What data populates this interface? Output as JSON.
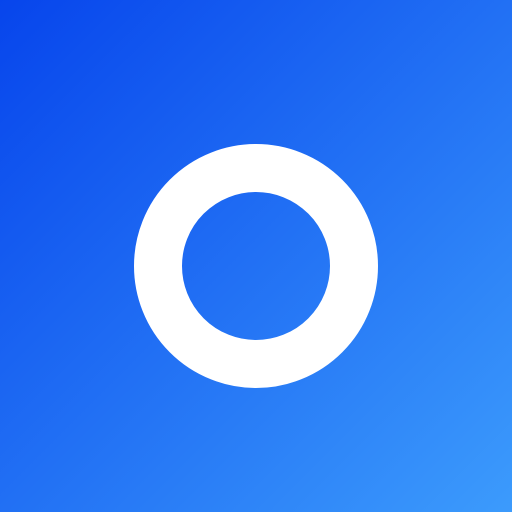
{
  "icon": {
    "name": "ring-logo-icon",
    "background_gradient": {
      "start_color": "#0745EC",
      "end_color": "#3C9BFC",
      "direction": "top-left-to-bottom-right"
    },
    "ring_color": "#FFFFFF"
  }
}
